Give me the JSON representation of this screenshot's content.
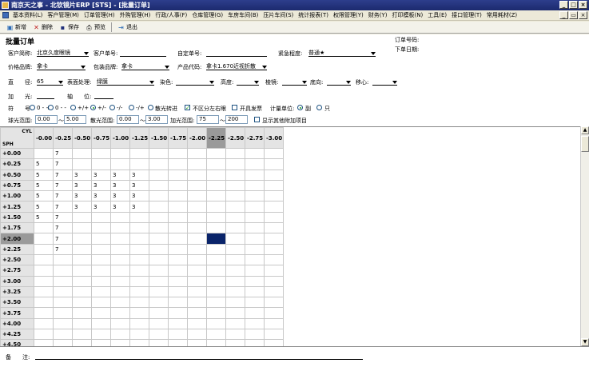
{
  "window": {
    "title": "南京天之事 - 北钦镜片ERP [STS] - [批量订单]",
    "min": "_",
    "max": "□",
    "close": "×"
  },
  "menu": [
    "基本资料(L)",
    "客户管理(M)",
    "订单管理(H)",
    "外购管理(H)",
    "行政/人事(F)",
    "仓库管理(G)",
    "车房车间(B)",
    "压片车间(S)",
    "统计报表(T)",
    "权限管理(Y)",
    "财务(Y)",
    "打印模板(N)",
    "工具(E)",
    "接口管理(T)",
    "常用耗材(Z)"
  ],
  "menu_controls": {
    "min": "_",
    "restore": "▭",
    "close": "×"
  },
  "toolbar": {
    "new": "新增",
    "delete": "删除",
    "save": "保存",
    "preview": "预览",
    "exit": "退出"
  },
  "form": {
    "title": "批量订单",
    "order_no_label": "订单号码:",
    "order_date_label": "下单日期:",
    "customer_label": "客户简称:",
    "customer_value": "北京久度眼镜",
    "customer_order_label": "客户单号:",
    "customer_order_value": "",
    "custom_order_label": "自定单号:",
    "custom_order_value": "",
    "urgency_label": "紧急程度:",
    "urgency_value": "普通★",
    "price_brand_label": "价格品牌:",
    "price_brand_value": "拿卡",
    "package_brand_label": "包装品牌:",
    "package_brand_value": "拿卡",
    "product_code_label": "产品代码:",
    "product_code_value": "拿卡1.670近视折散",
    "diameter_label": "直　　径:",
    "diameter_value": "65",
    "surface_label": "表面处理:",
    "surface_value": "绿膜",
    "dye_label": "染色:",
    "dye_value": "",
    "height_label": "高度:",
    "height_value": "",
    "prism_label": "棱镜:",
    "prism_value": "",
    "base_label": "底向:",
    "base_value": "",
    "decenter_label": "移心:",
    "decenter_value": "",
    "add_label": "加　　光:",
    "add_value": "",
    "axis_label": "轴　　位:",
    "axis_value": "",
    "sign_label": "符　　号:",
    "sign_options": [
      "0 - +",
      "0 - -",
      "+/+",
      "+/-",
      "-/-",
      "-/+",
      "散光转进"
    ],
    "sign_selected": 3,
    "no_lr_label": "不区分左右眼",
    "no_lr_checked": true,
    "invoice_label": "开具发票",
    "invoice_checked": false,
    "unit_label": "计量单位:",
    "unit_options": [
      "副",
      "只"
    ],
    "unit_selected": 0,
    "sph_range_label": "球光范围:",
    "sph_from": "0.00",
    "sph_to": "5.00",
    "cyl_range_label": "散光范围:",
    "cyl_from": "0.00",
    "cyl_to": "3.00",
    "add_range_label": "加光范围:",
    "add_from": "75",
    "add_to": "200",
    "show_other_label": "显示其他附加项目",
    "show_other_checked": false,
    "tilde": "～"
  },
  "grid": {
    "corner_cyl": "CYL",
    "corner_sph": "SPH",
    "cyl": [
      "-0.00",
      "-0.25",
      "-0.50",
      "-0.75",
      "-1.00",
      "-1.25",
      "-1.50",
      "-1.75",
      "-2.00",
      "-2.25",
      "-2.50",
      "-2.75",
      "-3.00"
    ],
    "selected_col": 9,
    "sph": [
      "+0.00",
      "+0.25",
      "+0.50",
      "+0.75",
      "+1.00",
      "+1.25",
      "+1.50",
      "+1.75",
      "+2.00",
      "+2.25",
      "+2.50",
      "+2.75",
      "+3.00",
      "+3.25",
      "+3.50",
      "+3.75",
      "+4.00",
      "+4.25",
      "+4.50"
    ],
    "selected_row": 8,
    "highlight": {
      "row": 8,
      "col": 9
    },
    "cells": [
      [
        "",
        "7",
        "",
        "",
        "",
        "",
        "",
        "",
        "",
        "",
        "",
        "",
        ""
      ],
      [
        "5",
        "7",
        "",
        "",
        "",
        "",
        "",
        "",
        "",
        "",
        "",
        "",
        ""
      ],
      [
        "5",
        "7",
        "3",
        "3",
        "3",
        "3",
        "",
        "",
        "",
        "",
        "",
        "",
        ""
      ],
      [
        "5",
        "7",
        "3",
        "3",
        "3",
        "3",
        "",
        "",
        "",
        "",
        "",
        "",
        ""
      ],
      [
        "5",
        "7",
        "3",
        "3",
        "3",
        "3",
        "",
        "",
        "",
        "",
        "",
        "",
        ""
      ],
      [
        "5",
        "7",
        "3",
        "3",
        "3",
        "3",
        "",
        "",
        "",
        "",
        "",
        "",
        ""
      ],
      [
        "5",
        "7",
        "",
        "",
        "",
        "",
        "",
        "",
        "",
        "",
        "",
        "",
        ""
      ],
      [
        "",
        "7",
        "",
        "",
        "",
        "",
        "",
        "",
        "",
        "",
        "",
        "",
        ""
      ],
      [
        "",
        "7",
        "",
        "",
        "",
        "",
        "",
        "",
        "",
        "",
        "",
        "",
        ""
      ],
      [
        "",
        "7",
        "",
        "",
        "",
        "",
        "",
        "",
        "",
        "",
        "",
        "",
        ""
      ],
      [
        "",
        "",
        "",
        "",
        "",
        "",
        "",
        "",
        "",
        "",
        "",
        "",
        ""
      ],
      [
        "",
        "",
        "",
        "",
        "",
        "",
        "",
        "",
        "",
        "",
        "",
        "",
        ""
      ],
      [
        "",
        "",
        "",
        "",
        "",
        "",
        "",
        "",
        "",
        "",
        "",
        "",
        ""
      ],
      [
        "",
        "",
        "",
        "",
        "",
        "",
        "",
        "",
        "",
        "",
        "",
        "",
        ""
      ],
      [
        "",
        "",
        "",
        "",
        "",
        "",
        "",
        "",
        "",
        "",
        "",
        "",
        ""
      ],
      [
        "",
        "",
        "",
        "",
        "",
        "",
        "",
        "",
        "",
        "",
        "",
        "",
        ""
      ],
      [
        "",
        "",
        "",
        "",
        "",
        "",
        "",
        "",
        "",
        "",
        "",
        "",
        ""
      ],
      [
        "",
        "",
        "",
        "",
        "",
        "",
        "",
        "",
        "",
        "",
        "",
        "",
        ""
      ],
      [
        "",
        "",
        "",
        "",
        "",
        "",
        "",
        "",
        "",
        "",
        "",
        "",
        ""
      ]
    ]
  },
  "footer": {
    "remark_label": "备　　注:",
    "remark_value": ""
  },
  "scroll": {
    "up": "▲",
    "down": "▼"
  }
}
